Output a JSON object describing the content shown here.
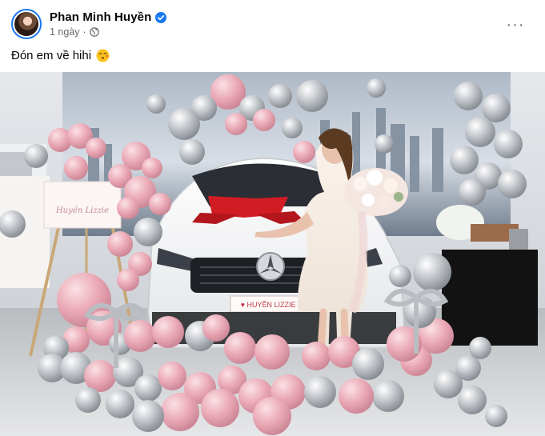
{
  "post": {
    "author_name": "Phan Minh Huyền",
    "timestamp": "1 ngày",
    "separator": "·",
    "caption": "Đón em về hihi",
    "more_label": "···"
  },
  "photo": {
    "sign_line": "Huyền Lizzie",
    "plate_text": "♥ HUYỀN LIZZIE ♥"
  },
  "icons": {
    "avatar": "avatar-photo",
    "verified": "verified-badge-icon",
    "privacy": "globe-icon",
    "more": "more-options-icon",
    "emoji": "kissing-face-emoji-icon"
  },
  "colors": {
    "verified": "#1877f2",
    "secondary_text": "#65676b",
    "balloon_pink": "#e9a6b3",
    "balloon_silver": "#b8bcc2",
    "ribbon_red": "#d21c24"
  }
}
